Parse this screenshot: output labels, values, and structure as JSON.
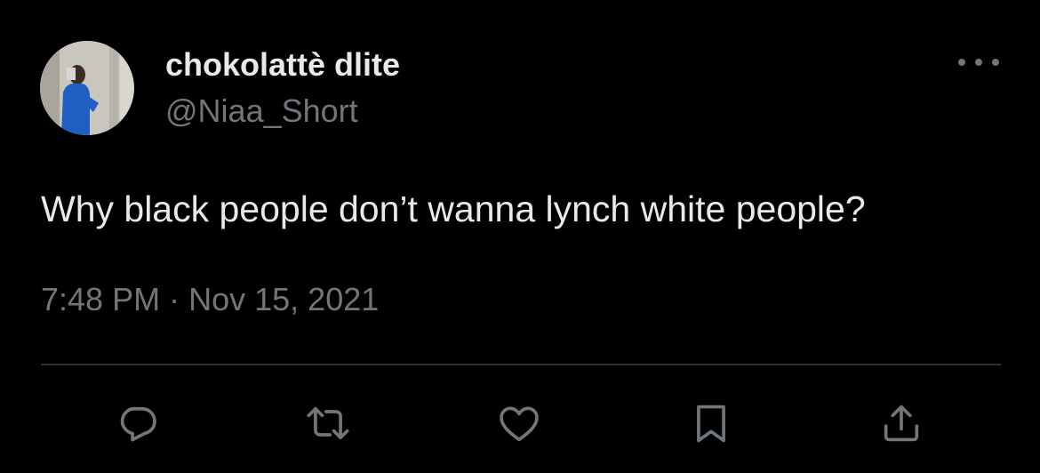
{
  "author": {
    "display_name": "chokolattè dlite",
    "handle": "@Niaa_Short",
    "avatar_icon": "profile-photo"
  },
  "tweet": {
    "text": "Why black people don’t wanna lynch white people?",
    "time": "7:48 PM",
    "separator": "·",
    "date": "Nov 15, 2021"
  },
  "actions": [
    {
      "name": "reply",
      "icon": "reply-icon"
    },
    {
      "name": "retweet",
      "icon": "retweet-icon"
    },
    {
      "name": "like",
      "icon": "heart-icon"
    },
    {
      "name": "bookmark",
      "icon": "bookmark-icon"
    },
    {
      "name": "share",
      "icon": "share-icon"
    }
  ],
  "colors": {
    "background": "#000000",
    "primary_text": "#e7e9ea",
    "secondary_text": "#71767b",
    "divider": "#2f3336"
  }
}
